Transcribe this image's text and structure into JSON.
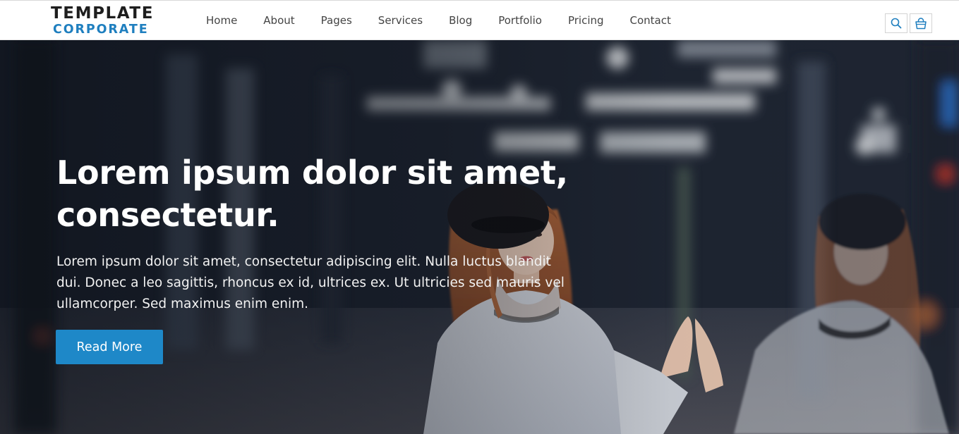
{
  "brand": {
    "line1": "TEMPLATE",
    "line2": "CORPORATE"
  },
  "nav": {
    "items": [
      {
        "label": "Home"
      },
      {
        "label": "About"
      },
      {
        "label": "Pages"
      },
      {
        "label": "Services"
      },
      {
        "label": "Blog"
      },
      {
        "label": "Portfolio"
      },
      {
        "label": "Pricing"
      },
      {
        "label": "Contact"
      }
    ]
  },
  "header_icons": {
    "search": "search-icon",
    "cart": "shopping-bag-icon",
    "color": "#1f7fbf"
  },
  "hero": {
    "title_line1": "Lorem ipsum dolor sit amet,",
    "title_line2": "consectetur.",
    "text": "Lorem ipsum dolor sit amet, consectetur adipiscing elit. Nulla luctus blandit dui. Donec a leo sagittis, rhoncus ex id, ultrices ex. Ut ultricies sed mauris vel ullamcorper. Sed maximus enim enim.",
    "button_label": "Read More"
  },
  "colors": {
    "accent": "#1e88c8",
    "brand_dark": "#1e1e1e",
    "brand_blue": "#1f7fbf"
  }
}
